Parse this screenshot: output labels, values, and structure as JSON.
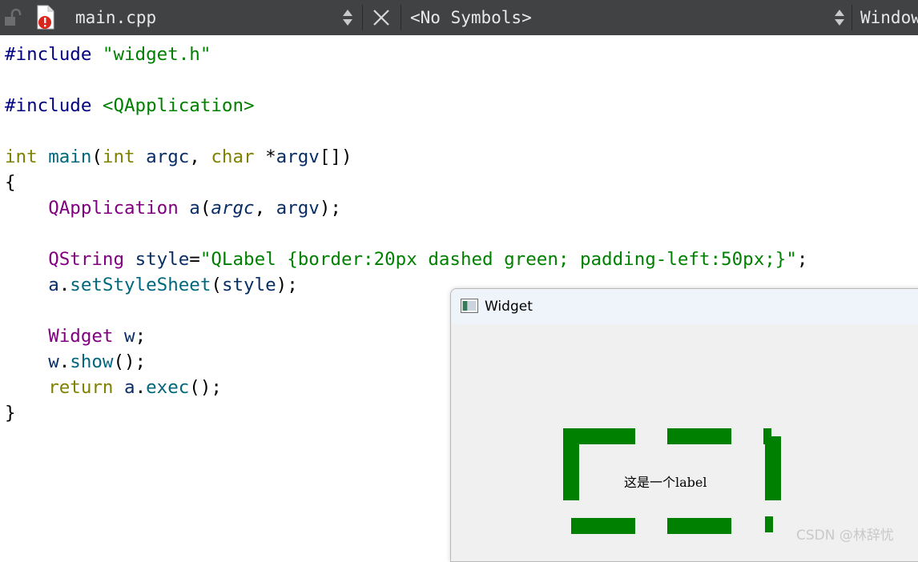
{
  "toolbar": {
    "file_name": "main.cpp",
    "symbols": "<No Symbols>",
    "window_label": "Window"
  },
  "code_lines": [
    [
      {
        "t": "#include ",
        "c": "pp"
      },
      {
        "t": "\"widget.h\"",
        "c": "str"
      }
    ],
    [],
    [
      {
        "t": "#include ",
        "c": "pp"
      },
      {
        "t": "<QApplication>",
        "c": "str"
      }
    ],
    [],
    [
      {
        "t": "int",
        "c": "kw"
      },
      {
        "t": " "
      },
      {
        "t": "main",
        "c": "fn"
      },
      {
        "t": "("
      },
      {
        "t": "int",
        "c": "kw"
      },
      {
        "t": " "
      },
      {
        "t": "argc",
        "c": "va"
      },
      {
        "t": ", "
      },
      {
        "t": "char",
        "c": "kw"
      },
      {
        "t": " *"
      },
      {
        "t": "argv",
        "c": "va"
      },
      {
        "t": "[])"
      }
    ],
    [
      {
        "t": "{"
      }
    ],
    [
      {
        "t": "    "
      },
      {
        "t": "QApplication",
        "c": "ty"
      },
      {
        "t": " "
      },
      {
        "t": "a",
        "c": "va"
      },
      {
        "t": "("
      },
      {
        "t": "argc",
        "c": "va it"
      },
      {
        "t": ", "
      },
      {
        "t": "argv",
        "c": "va"
      },
      {
        "t": ");"
      }
    ],
    [],
    [
      {
        "t": "    "
      },
      {
        "t": "QString",
        "c": "ty"
      },
      {
        "t": " "
      },
      {
        "t": "style",
        "c": "va"
      },
      {
        "t": "="
      },
      {
        "t": "\"QLabel {border:20px dashed green; padding-left:50px;}\"",
        "c": "str"
      },
      {
        "t": ";"
      }
    ],
    [
      {
        "t": "    "
      },
      {
        "t": "a",
        "c": "va"
      },
      {
        "t": "."
      },
      {
        "t": "setStyleSheet",
        "c": "fn"
      },
      {
        "t": "("
      },
      {
        "t": "style",
        "c": "va"
      },
      {
        "t": ");"
      }
    ],
    [],
    [
      {
        "t": "    "
      },
      {
        "t": "Widget",
        "c": "ty"
      },
      {
        "t": " "
      },
      {
        "t": "w",
        "c": "va"
      },
      {
        "t": ";"
      }
    ],
    [
      {
        "t": "    "
      },
      {
        "t": "w",
        "c": "va"
      },
      {
        "t": "."
      },
      {
        "t": "show",
        "c": "fn"
      },
      {
        "t": "();"
      }
    ],
    [
      {
        "t": "    "
      },
      {
        "t": "return",
        "c": "kw"
      },
      {
        "t": " "
      },
      {
        "t": "a",
        "c": "va"
      },
      {
        "t": "."
      },
      {
        "t": "exec",
        "c": "fn"
      },
      {
        "t": "();"
      }
    ],
    [
      {
        "t": "}"
      }
    ]
  ],
  "widget_window": {
    "title": "Widget",
    "label_text": "这是一个label",
    "border_color": "#008000"
  },
  "watermark": "CSDN @林辞忧",
  "colors": {
    "toolbar_bg": "#404244",
    "preprocessor": "#000080",
    "string": "#008000",
    "keyword": "#808000",
    "function": "#00677c",
    "type": "#800080",
    "variable": "#092e64"
  }
}
